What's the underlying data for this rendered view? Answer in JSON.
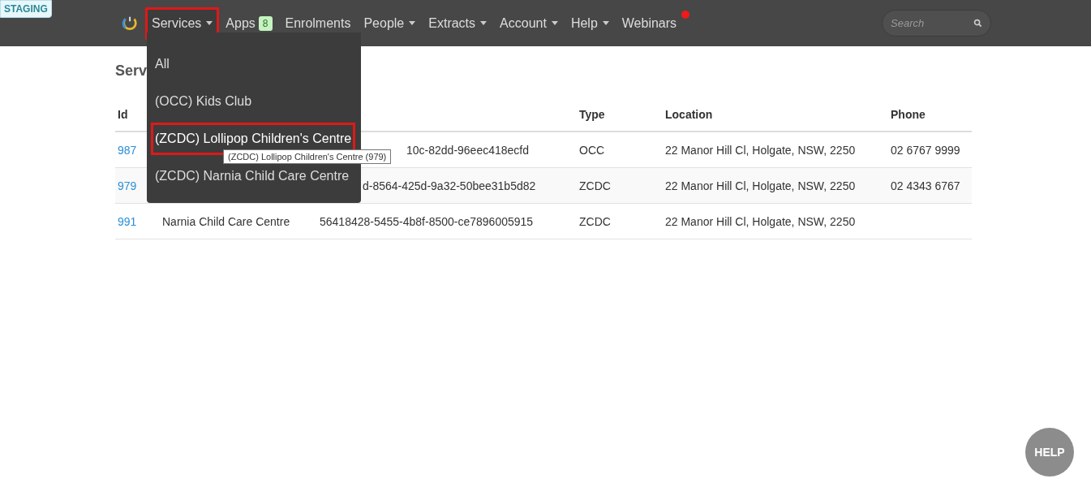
{
  "environment_badge": "STAGING",
  "nav": {
    "items": [
      {
        "label": "Services",
        "dropdown": true,
        "highlighted": true
      },
      {
        "label": "Apps",
        "badge": "8",
        "dropdown": false,
        "highlighted": false
      },
      {
        "label": "Enrolments",
        "dropdown": false,
        "highlighted": false
      },
      {
        "label": "People",
        "dropdown": true,
        "highlighted": false
      },
      {
        "label": "Extracts",
        "dropdown": true,
        "highlighted": false
      },
      {
        "label": "Account",
        "dropdown": true,
        "highlighted": false
      },
      {
        "label": "Help",
        "dropdown": true,
        "highlighted": false
      },
      {
        "label": "Webinars",
        "dropdown": false,
        "highlighted": false,
        "notification": true
      }
    ],
    "search": {
      "placeholder": "Search"
    }
  },
  "page_title": "Serv",
  "table": {
    "columns": [
      {
        "label": "Id"
      },
      {},
      {},
      {
        "label": "Type"
      },
      {
        "label": "Location"
      },
      {
        "label": "Phone"
      }
    ],
    "rows": [
      {
        "id": "987",
        "uid": "10c-82dd-96eec418ecfd",
        "kind": "tooltip",
        "type": "OCC",
        "location": "22 Manor Hill Cl, Holgate, NSW, 2250",
        "phone": "02 6767 9999"
      },
      {
        "id": "979",
        "uid": "d-8564-425d-9a32-50bee31b5d82",
        "kind": "menu",
        "type": "ZCDC",
        "location": "22 Manor Hill Cl, Holgate, NSW, 2250",
        "phone": "02 4343 6767"
      },
      {
        "kind": "plain",
        "id": "991",
        "name": "Narnia Child Care Centre",
        "uid": "56418428-5455-4b8f-8500-ce7896005915",
        "type": "ZCDC",
        "location": "22 Manor Hill Cl, Holgate, NSW, 2250"
      }
    ]
  },
  "services_menu": {
    "items": [
      {
        "label": "All",
        "highlighted": false
      },
      {
        "label": "(OCC) Kids Club",
        "highlighted": false
      },
      {
        "label": "(ZCDC) Lollipop Children's Centre",
        "highlighted": true
      },
      {
        "label": "(ZCDC) Narnia Child Care Centre",
        "highlighted": false
      }
    ]
  },
  "tooltip": "(ZCDC) Lollipop Children's Centre (979)",
  "help_button": "HELP"
}
